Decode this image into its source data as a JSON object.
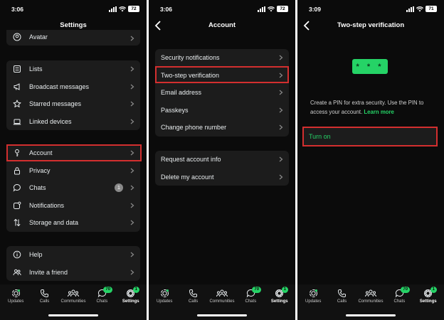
{
  "status": {
    "s1_time": "3:06",
    "s2_time": "3:06",
    "s3_time": "3:09",
    "s1_battery": "72",
    "s2_battery": "72",
    "s3_battery": "71"
  },
  "settings": {
    "title": "Settings",
    "top_partial": {
      "label": "Avatar",
      "icon": "avatar-icon"
    },
    "group1": [
      {
        "label": "Lists",
        "icon": "lists-icon"
      },
      {
        "label": "Broadcast messages",
        "icon": "megaphone-icon"
      },
      {
        "label": "Starred messages",
        "icon": "star-icon"
      },
      {
        "label": "Linked devices",
        "icon": "laptop-icon"
      }
    ],
    "group2": [
      {
        "label": "Account",
        "icon": "key-icon"
      },
      {
        "label": "Privacy",
        "icon": "lock-icon"
      },
      {
        "label": "Chats",
        "icon": "chat-bubble-icon",
        "badge": "1"
      },
      {
        "label": "Notifications",
        "icon": "bell-notification-icon"
      },
      {
        "label": "Storage and data",
        "icon": "arrows-updown-icon"
      }
    ],
    "group3": [
      {
        "label": "Help",
        "icon": "info-icon"
      },
      {
        "label": "Invite a friend",
        "icon": "people-icon"
      }
    ]
  },
  "account": {
    "title": "Account",
    "group1": [
      {
        "label": "Security notifications"
      },
      {
        "label": "Two-step verification"
      },
      {
        "label": "Email address"
      },
      {
        "label": "Passkeys"
      },
      {
        "label": "Change phone number"
      }
    ],
    "group2": [
      {
        "label": "Request account info"
      },
      {
        "label": "Delete my account"
      }
    ]
  },
  "two_step": {
    "title": "Two-step verification",
    "pin_mask": "* * *",
    "description": "Create a PIN for extra security. Use the PIN to access your account.",
    "learn_more": "Learn more",
    "turn_on": "Turn on"
  },
  "nav": {
    "tabs": [
      {
        "label": "Updates",
        "icon": "updates-icon"
      },
      {
        "label": "Calls",
        "icon": "phone-icon"
      },
      {
        "label": "Communities",
        "icon": "communities-icon"
      },
      {
        "label": "Chats",
        "icon": "chats-tab-icon",
        "badge": "70"
      },
      {
        "label": "Settings",
        "icon": "settings-avatar-icon",
        "badge": "1"
      }
    ]
  },
  "colors": {
    "background": "#0b0b0b",
    "group": "#1c1c1c",
    "accent_green": "#25d366",
    "highlight_red": "#d32f2f"
  }
}
